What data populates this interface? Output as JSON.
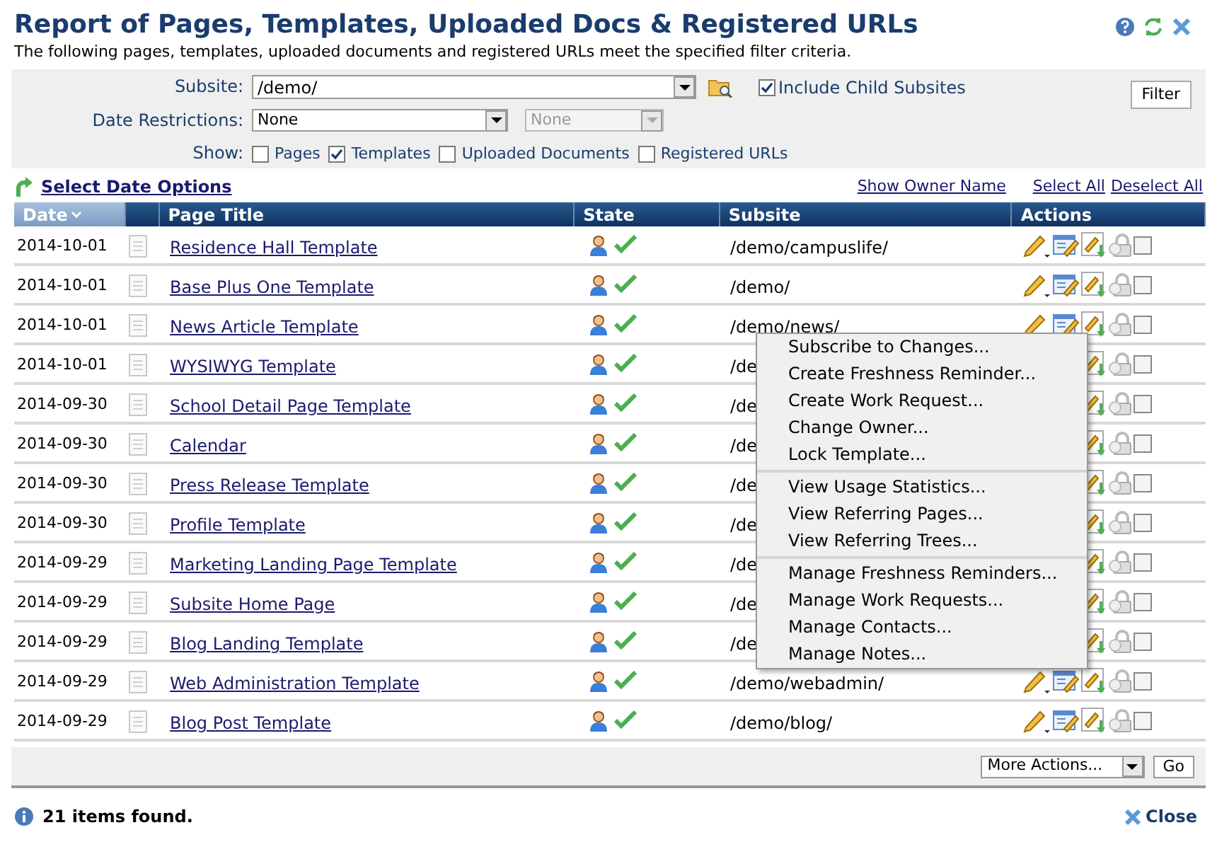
{
  "title": "Report of Pages, Templates, Uploaded Docs & Registered URLs",
  "subtitle": "The following pages, templates, uploaded documents and registered URLs meet the specified filter criteria.",
  "filter": {
    "subsite_label": "Subsite:",
    "subsite_value": "/demo/",
    "include_child": {
      "label": "Include Child Subsites",
      "checked": true
    },
    "date_label": "Date Restrictions:",
    "date_value": "None",
    "date_value_2": "None",
    "show_label": "Show:",
    "show_options": [
      {
        "label": "Pages",
        "checked": false
      },
      {
        "label": "Templates",
        "checked": true
      },
      {
        "label": "Uploaded Documents",
        "checked": false
      },
      {
        "label": "Registered URLs",
        "checked": false
      }
    ],
    "filter_button": "Filter"
  },
  "links": {
    "select_date": "Select Date Options",
    "show_owner": "Show Owner Name",
    "select_all": "Select All",
    "deselect_all": "Deselect All"
  },
  "columns": [
    {
      "label": "Date",
      "sorted": true
    },
    {
      "sorted": false
    },
    {
      "label": "Page Title",
      "sorted": false
    },
    {
      "label": "State",
      "sorted": false
    },
    {
      "label": "Subsite",
      "sorted": false
    },
    {
      "label": "Actions",
      "sorted": false
    }
  ],
  "rows": [
    {
      "date": "2014-10-01",
      "title": "Residence Hall Template",
      "subsite": "/demo/campuslife/",
      "checked": false
    },
    {
      "date": "2014-10-01",
      "title": "Base Plus One Template",
      "subsite": "/demo/",
      "checked": false
    },
    {
      "date": "2014-10-01",
      "title": "News Article Template",
      "subsite": "/demo/news/",
      "checked": false
    },
    {
      "date": "2014-10-01",
      "title": "WYSIWYG Template",
      "subsite": "/de",
      "actions": [
        {
          "kind": "publish"
        },
        {
          "kind": "lock"
        }
      ],
      "checked": false
    },
    {
      "date": "2014-09-30",
      "title": "School Detail Page Template",
      "subsite": "/de",
      "actions": [
        {
          "kind": "publish"
        },
        {
          "kind": "lock"
        }
      ],
      "checked": false
    },
    {
      "date": "2014-09-30",
      "title": "Calendar",
      "subsite": "/de",
      "actions": [
        {
          "kind": "publish"
        },
        {
          "kind": "lock"
        }
      ],
      "checked": false
    },
    {
      "date": "2014-09-30",
      "title": "Press Release Template",
      "subsite": "/de",
      "actions": [
        {
          "kind": "publish"
        },
        {
          "kind": "lock"
        }
      ],
      "checked": false
    },
    {
      "date": "2014-09-30",
      "title": "Profile Template",
      "subsite": "/de",
      "actions": [
        {
          "kind": "publish"
        },
        {
          "kind": "lock"
        }
      ],
      "checked": false
    },
    {
      "date": "2014-09-29",
      "title": "Marketing Landing Page Template",
      "subsite": "/de",
      "actions": [
        {
          "kind": "publish"
        },
        {
          "kind": "lock"
        }
      ],
      "checked": false
    },
    {
      "date": "2014-09-29",
      "title": "Subsite Home Page",
      "subsite": "/de",
      "actions": [
        {
          "kind": "publish"
        },
        {
          "kind": "lock"
        }
      ],
      "checked": false
    },
    {
      "date": "2014-09-29",
      "title": "Blog Landing Template",
      "subsite": "/de",
      "actions": [
        {
          "kind": "publish"
        },
        {
          "kind": "lock"
        }
      ],
      "checked": false
    },
    {
      "date": "2014-09-29",
      "title": "Web Administration Template",
      "subsite": "/demo/webadmin/",
      "checked": false
    },
    {
      "date": "2014-09-29",
      "title": "Blog Post Template",
      "subsite": "/demo/blog/",
      "checked": false
    }
  ],
  "context_menu": [
    [
      "Subscribe to Changes...",
      "Create Freshness Reminder...",
      "Create Work Request...",
      "Change Owner...",
      "Lock Template..."
    ],
    [
      "View Usage Statistics...",
      "View Referring Pages...",
      "View Referring Trees..."
    ],
    [
      "Manage Freshness Reminders...",
      "Manage Work Requests...",
      "Manage Contacts...",
      "Manage Notes..."
    ]
  ],
  "more_actions": "More Actions...",
  "go_button": "Go",
  "status": "21 items found.",
  "close": "Close"
}
